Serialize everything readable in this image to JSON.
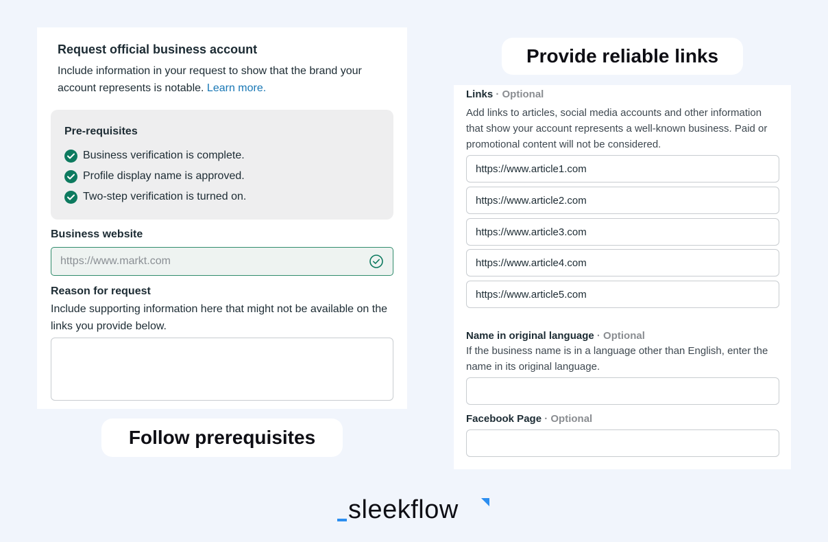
{
  "left_card": {
    "title": "Request official business account",
    "description": "Include information in your request to show that the brand your account represents is notable.",
    "learn_more": "Learn more.",
    "prerequisites": {
      "title": "Pre-requisites",
      "items": [
        "Business verification is complete.",
        "Profile display name is approved.",
        "Two-step verification is turned on."
      ]
    },
    "business_website": {
      "label": "Business website",
      "value": "https://www.markt.com"
    },
    "reason": {
      "label": "Reason for request",
      "description": "Include supporting information here that might not be available on the links you provide below.",
      "value": ""
    }
  },
  "pills": {
    "follow": "Follow prerequisites",
    "provide": "Provide reliable links"
  },
  "right_card": {
    "links": {
      "label": "Links",
      "optional": " · Optional",
      "description": "Add links to articles, social media accounts and other information that show your account represents a well-known business. Paid or promotional content will not be considered.",
      "values": [
        "https://www.article1.com",
        "https://www.article2.com",
        "https://www.article3.com",
        "https://www.article4.com",
        "https://www.article5.com"
      ]
    },
    "original_name": {
      "label": "Name in original language",
      "optional": " · Optional",
      "description": "If the business name is in a language other than English, enter the name in its original language.",
      "value": ""
    },
    "facebook_page": {
      "label": "Facebook Page",
      "optional": " · Optional",
      "value": ""
    }
  },
  "logo": {
    "text": "sleekflow"
  },
  "colors": {
    "background": "#f1f5fc",
    "check_green": "#0d7a5f",
    "link_blue": "#1877b5",
    "logo_blue": "#2c8ef0"
  }
}
